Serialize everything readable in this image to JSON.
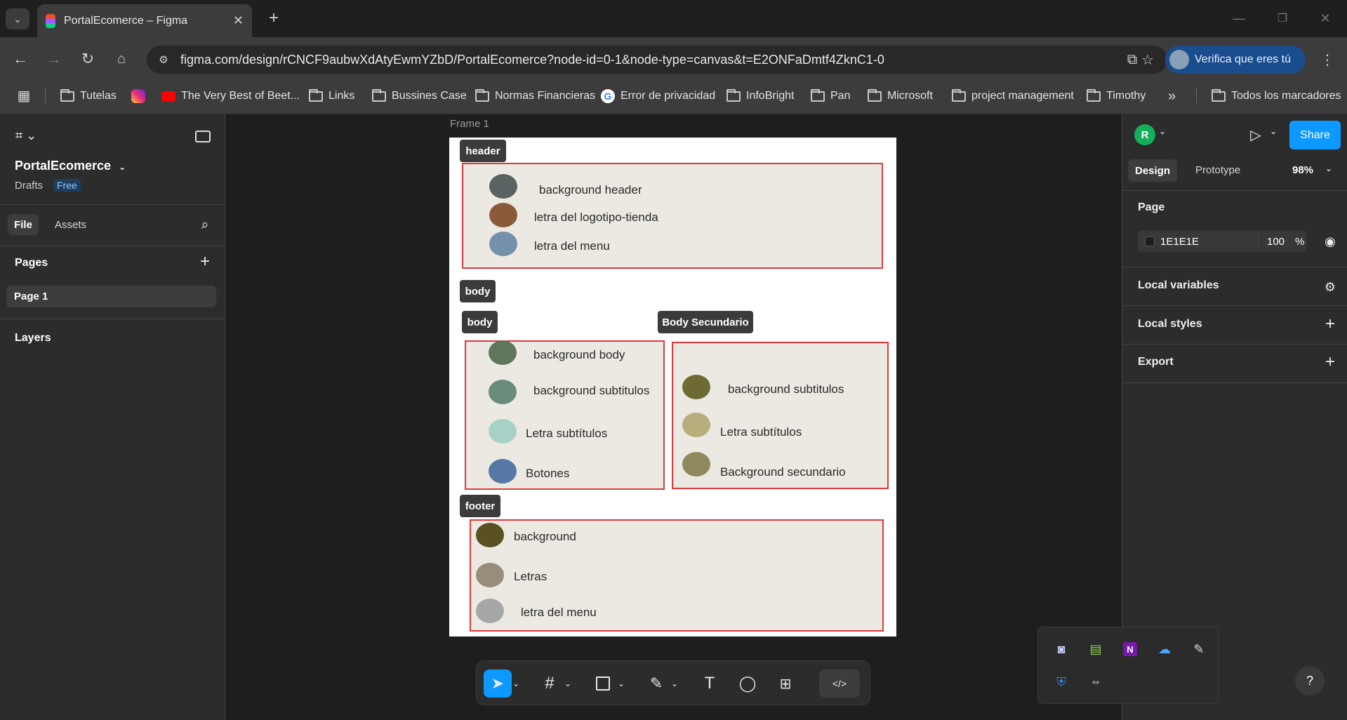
{
  "browser": {
    "tab_title": "PortalEcomerce – Figma",
    "url": "figma.com/design/rCNCF9aubwXdAtyEwmYZbD/PortalEcomerce?node-id=0-1&node-type=canvas&t=E2ONFaDmtf4ZknC1-0",
    "profile_button": "Verifica que eres tú",
    "bookmarks": [
      {
        "label": "Tutelas",
        "icon": "folder-icon"
      },
      {
        "label": "",
        "icon": "instagram-icon"
      },
      {
        "label": "The Very Best of Beet...",
        "icon": "youtube-icon"
      },
      {
        "label": "Links",
        "icon": "folder-icon"
      },
      {
        "label": "Bussines Case",
        "icon": "folder-icon"
      },
      {
        "label": "Normas Financieras",
        "icon": "folder-icon"
      },
      {
        "label": "Error de privacidad",
        "icon": "google-icon"
      },
      {
        "label": "InfoBright",
        "icon": "folder-icon"
      },
      {
        "label": "Pan",
        "icon": "folder-icon"
      },
      {
        "label": "Microsoft",
        "icon": "folder-icon"
      },
      {
        "label": "project management",
        "icon": "folder-icon"
      },
      {
        "label": "Timothy",
        "icon": "folder-icon"
      }
    ],
    "all_bookmarks": "Todos los marcadores",
    "overflow": "»"
  },
  "figma": {
    "file_name": "PortalEcomerce",
    "location": "Drafts",
    "plan_badge": "Free",
    "left_tabs": [
      "File",
      "Assets"
    ],
    "pages_title": "Pages",
    "page_item": "Page 1",
    "layers_title": "Layers",
    "avatar_letter": "R",
    "share": "Share",
    "right_tabs": [
      "Design",
      "Prototype"
    ],
    "zoom": "98%",
    "page_section": "Page",
    "page_color": "1E1E1E",
    "page_opacity": "100",
    "percent": "%",
    "local_variables": "Local variables",
    "local_styles": "Local styles",
    "export": "Export",
    "help": "?"
  },
  "canvas": {
    "frame_label": "Frame 1",
    "header_tag": "header",
    "body_tag": "body",
    "body_sub_tag": "body",
    "body_secondary_tag": "Body Secundario",
    "footer_tag": "footer",
    "header_items": [
      {
        "label": "background header",
        "color": "#5b6262"
      },
      {
        "label": "letra del logotipo-tienda",
        "color": "#8a5a3a"
      },
      {
        "label": "letra del menu",
        "color": "#7590ab"
      }
    ],
    "body_items": [
      {
        "label": "background body",
        "color": "#5f755c"
      },
      {
        "label": "background subtitulos",
        "color": "#6b8c7a"
      },
      {
        "label": "Letra subtítulos",
        "color": "#a7d1c6"
      },
      {
        "label": "Botones",
        "color": "#5578a6"
      }
    ],
    "secondary_items": [
      {
        "label": "background subtitulos",
        "color": "#6d6a34"
      },
      {
        "label": "Letra subtítulos",
        "color": "#b9ad7d"
      },
      {
        "label": "Background secundario",
        "color": "#8e8a5d"
      }
    ],
    "footer_items": [
      {
        "label": "background",
        "color": "#5a5022"
      },
      {
        "label": "Letras",
        "color": "#978d79"
      },
      {
        "label": "letra del menu",
        "color": "#a4a7a6"
      }
    ]
  },
  "colors": {
    "accent": "#0d99ff",
    "box_border": "#e0393d",
    "box_fill": "#ece9e2",
    "avatar": "#14ae5c"
  }
}
